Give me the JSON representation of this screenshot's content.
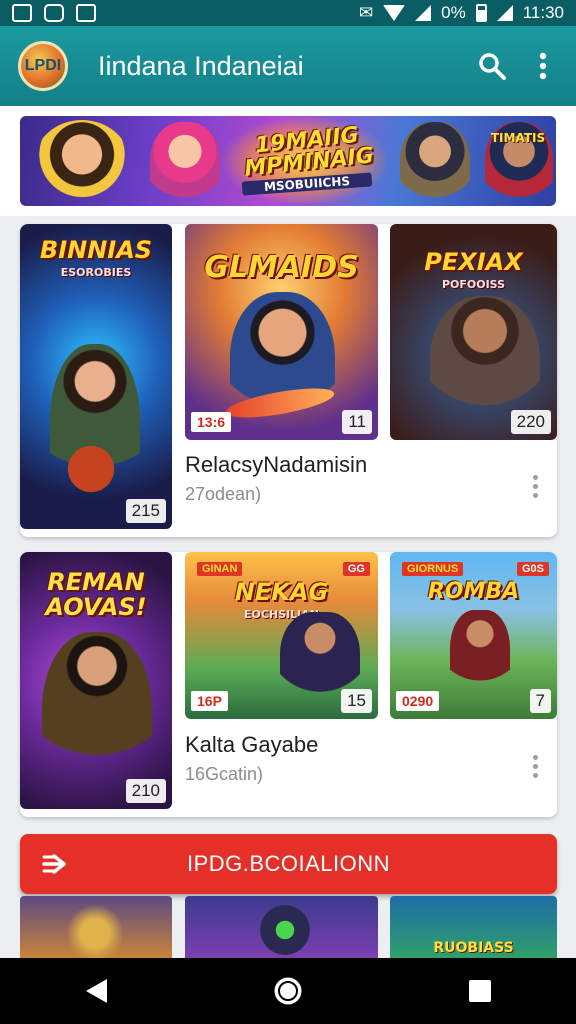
{
  "status_bar": {
    "time": "11:30",
    "battery": "0%"
  },
  "app_bar": {
    "logo_text": "LPDI",
    "title": "Iindana Indaneiai"
  },
  "banner": {
    "title": "19MAIIG MPMINAIG",
    "subtitle": "MSOBUIICHS",
    "badge": "TIMATIS"
  },
  "cards": [
    {
      "title": "RelacsyNadamisin",
      "subtitle": "27odean)",
      "tiles": [
        {
          "title": "BINNIAS",
          "sub": "ESOROBIES",
          "count": "215"
        },
        {
          "title": "GLMAIDS",
          "sub": "",
          "count": "11",
          "tag": "13:6"
        },
        {
          "title": "PEXIAX",
          "sub": "POFOOISS",
          "count": "220"
        }
      ]
    },
    {
      "title": "Kalta Gayabe",
      "subtitle": "16Gcatin)",
      "tiles": [
        {
          "title": "REMAN AOVAS!",
          "sub": "",
          "count": "210"
        },
        {
          "title": "NEKAG",
          "sub": "EOCHSILIAN",
          "count": "15",
          "tag": "16P",
          "top_tag": "GINAN",
          "top_right_tag": "GG"
        },
        {
          "title": "ROMBA",
          "sub": "",
          "count": "7",
          "tag": "0290",
          "top_tag": "GIORNUS",
          "top_right_tag": "G0S"
        }
      ]
    }
  ],
  "promo": {
    "label": "IPDG.BCOIALIONN"
  },
  "peek": {
    "label": "RUOBIASS"
  },
  "colors": {
    "app_bar": "#1b9aa0",
    "status_bar": "#0a5e63",
    "promo": "#e53029"
  },
  "icons": {
    "search": "search-icon",
    "menu": "more-vert-icon",
    "back": "back-icon",
    "home": "home-icon",
    "recents": "recents-icon"
  }
}
